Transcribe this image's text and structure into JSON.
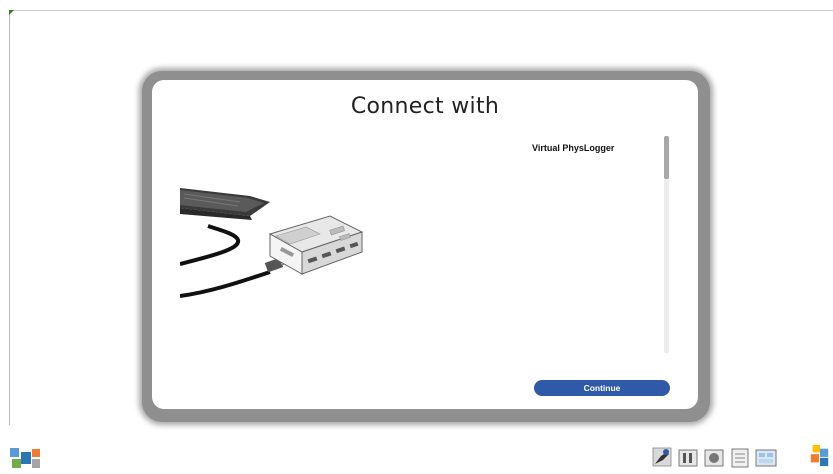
{
  "dialog": {
    "title": "Connect with",
    "devices": [
      "Virtual PhysLogger"
    ],
    "continue_label": "Continue"
  },
  "colors": {
    "button": "#2e5aa8",
    "frame_shadow": "#8f8f8f",
    "scroll_thumb": "#a8a8a8"
  },
  "taskbar": {
    "left_icons": [
      "app-menu-icon"
    ],
    "right_icons": [
      "probe-icon",
      "pause-icon",
      "record-icon",
      "notes-icon",
      "screen-icon",
      "settings-icon"
    ]
  }
}
